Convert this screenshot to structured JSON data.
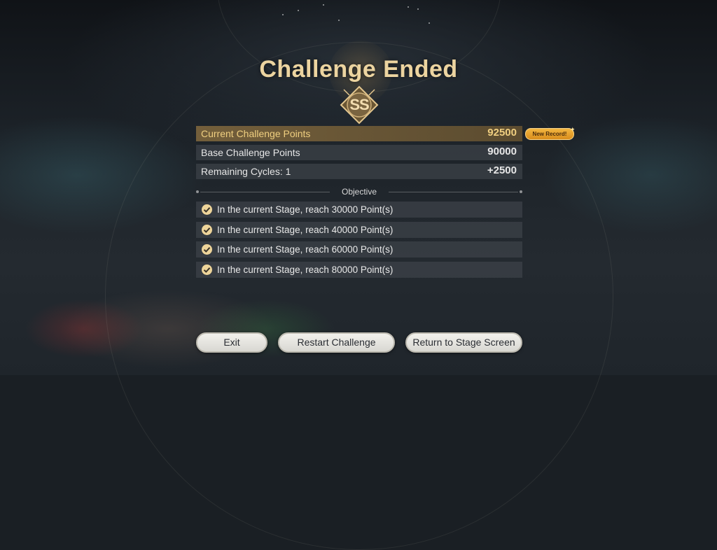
{
  "title": "Challenge Ended",
  "rank": "SS",
  "scores": [
    {
      "label": "Current Challenge Points",
      "value": "92500"
    },
    {
      "label": "Base Challenge Points",
      "value": "90000"
    },
    {
      "label": "Remaining Cycles: 1",
      "value": "+2500"
    }
  ],
  "new_record_badge": "New Record!",
  "objective_header": "Objective",
  "objectives": [
    "In the current Stage, reach 30000 Point(s)",
    "In the current Stage, reach 40000 Point(s)",
    "In the current Stage, reach 60000 Point(s)",
    "In the current Stage, reach 80000 Point(s)"
  ],
  "buttons": {
    "exit": "Exit",
    "restart": "Restart Challenge",
    "return": "Return to Stage Screen"
  },
  "colors": {
    "accent_gold": "#ecd4a0",
    "highlight_row": "#78623c",
    "badge": "#f3b640"
  },
  "icons": {
    "rank_emblem": "rank-emblem-icon",
    "objective_complete": "check-circle-icon"
  }
}
